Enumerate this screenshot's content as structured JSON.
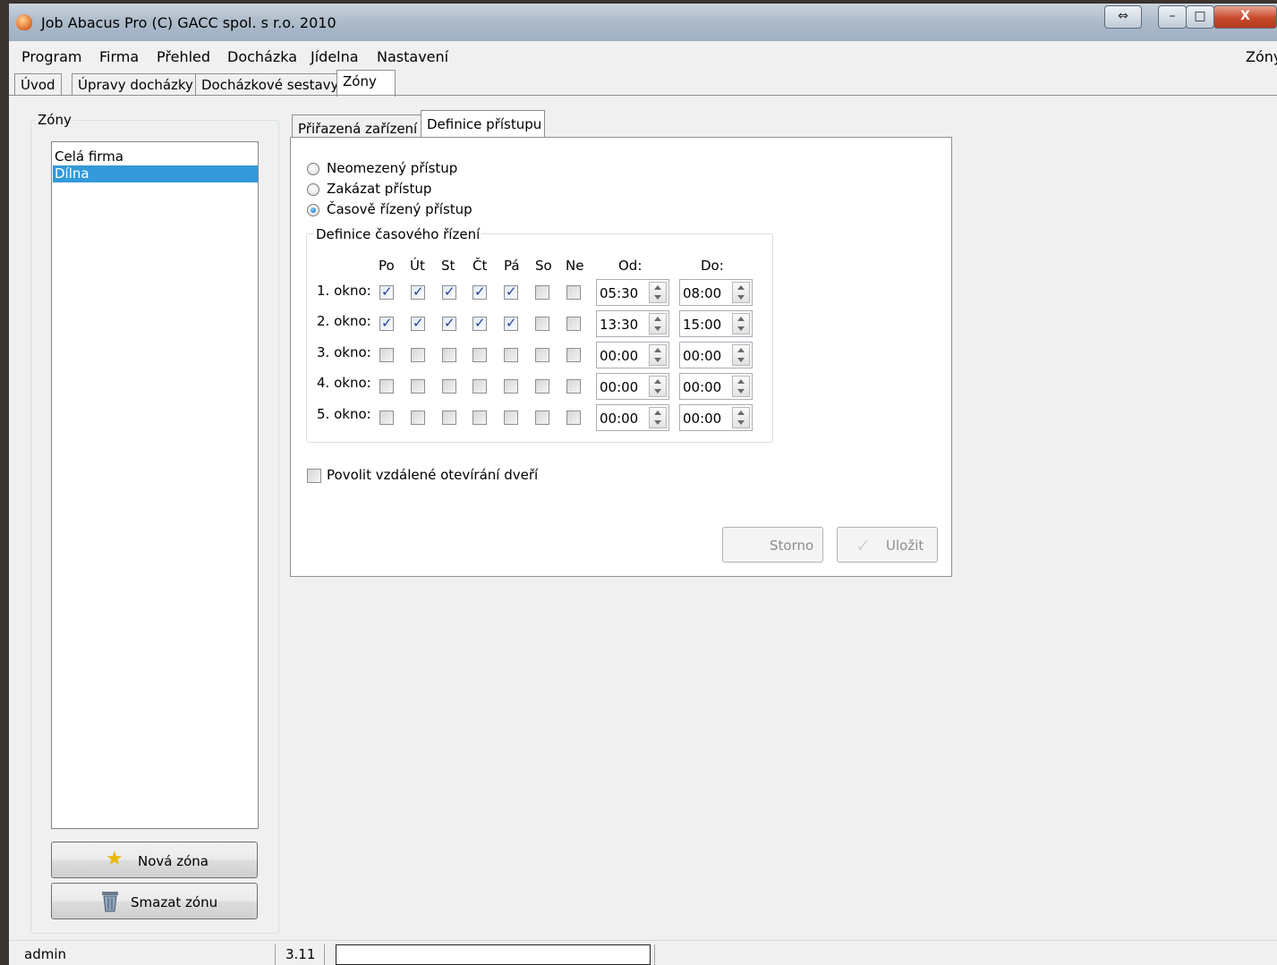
{
  "window": {
    "title": "Job Abacus Pro (C) GACC spol. s r.o. 2010",
    "controls": {
      "restore": "⇔",
      "minimize": "–",
      "maximize": "□",
      "close": "X"
    }
  },
  "menu": {
    "items": [
      "Program",
      "Firma",
      "Přehled",
      "Docházka",
      "Jídelna",
      "Nastavení"
    ],
    "right_label": "Zóny"
  },
  "main_tabs": [
    "Úvod",
    "Úpravy docházky",
    "Docházkové sestavy",
    "Zóny"
  ],
  "zones": {
    "group_title": "Zóny",
    "items": [
      "Celá firma",
      "Dílna"
    ],
    "selected": "Dílna",
    "new_button": "Nová zóna",
    "delete_button": "Smazat zónu"
  },
  "sub_tabs": [
    "Přiřazená zařízení",
    "Definice přístupu"
  ],
  "access": {
    "options": [
      "Neomezený přístup",
      "Zakázat přístup",
      "Časově řízený přístup"
    ],
    "selected": "Časově řízený přístup"
  },
  "time_control": {
    "group_title": "Definice časového řízení",
    "days": [
      "Po",
      "Út",
      "St",
      "Čt",
      "Pá",
      "So",
      "Ne"
    ],
    "from_header": "Od:",
    "to_header": "Do:",
    "windows": [
      {
        "label": "1. okno:",
        "days": [
          true,
          true,
          true,
          true,
          true,
          false,
          false
        ],
        "from": "05:30",
        "to": "08:00"
      },
      {
        "label": "2. okno:",
        "days": [
          true,
          true,
          true,
          true,
          true,
          false,
          false
        ],
        "from": "13:30",
        "to": "15:00"
      },
      {
        "label": "3. okno:",
        "days": [
          false,
          false,
          false,
          false,
          false,
          false,
          false
        ],
        "from": "00:00",
        "to": "00:00"
      },
      {
        "label": "4. okno:",
        "days": [
          false,
          false,
          false,
          false,
          false,
          false,
          false
        ],
        "from": "00:00",
        "to": "00:00"
      },
      {
        "label": "5. okno:",
        "days": [
          false,
          false,
          false,
          false,
          false,
          false,
          false
        ],
        "from": "00:00",
        "to": "00:00"
      }
    ]
  },
  "remote_open": {
    "label": "Povolit vzdálené otevírání dveří",
    "checked": false
  },
  "buttons": {
    "cancel": "Storno",
    "save": "Uložit"
  },
  "status": {
    "user": "admin",
    "version": "3.11",
    "field": ""
  }
}
